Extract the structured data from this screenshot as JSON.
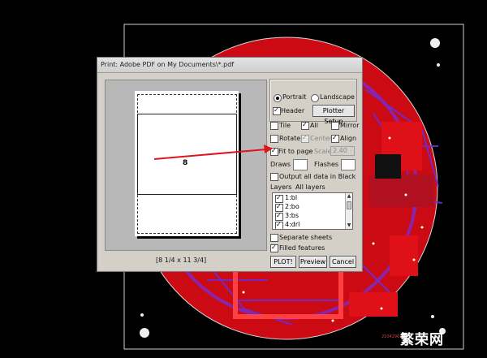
{
  "dialog": {
    "title": "Print: Adobe PDF on My Documents\\*.pdf",
    "preview": {
      "board_number": "8",
      "paper_size": "[8 1/4 x 11 3/4]"
    },
    "orientation": {
      "portrait_label": "Portrait",
      "portrait_selected": true,
      "landscape_label": "Landscape",
      "landscape_selected": false
    },
    "header": {
      "label": "Header",
      "checked": true
    },
    "plotter_setup_label": "Plotter Setup",
    "tile": {
      "label": "Tile",
      "checked": false
    },
    "all": {
      "label": "All",
      "checked": true
    },
    "mirror": {
      "label": "Mirror",
      "checked": false
    },
    "rotate": {
      "label": "Rotate",
      "checked": false
    },
    "center": {
      "label": "Center",
      "checked": true
    },
    "align": {
      "label": "Align",
      "checked": true
    },
    "fit_to_page": {
      "label": "Fit to page",
      "checked": true
    },
    "scale": {
      "label": "Scale",
      "value": "2.40"
    },
    "draws_label": "Draws",
    "flashes_label": "Flashes",
    "output_black": {
      "label": "Output all data in Black",
      "checked": false
    },
    "layers_label": "Layers",
    "layers_value": "All layers",
    "layers": [
      {
        "name": "1:bl",
        "checked": true
      },
      {
        "name": "2:bo",
        "checked": true
      },
      {
        "name": "3:bs",
        "checked": true
      },
      {
        "name": "4:drl",
        "checked": true
      }
    ],
    "separate_sheets": {
      "label": "Separate sheets",
      "checked": false
    },
    "filled_features": {
      "label": "Filled features",
      "checked": true
    },
    "buttons": {
      "plot": "PLOT!",
      "preview": "Preview",
      "cancel": "Cancel"
    }
  },
  "watermark": {
    "text": "繁荣网",
    "small": "210429023"
  },
  "colors": {
    "pcb_red": "#e8101a",
    "pcb_purple": "#5a2ab0",
    "arrow": "#e0141c",
    "dialog_bg": "#d4d0c8"
  }
}
